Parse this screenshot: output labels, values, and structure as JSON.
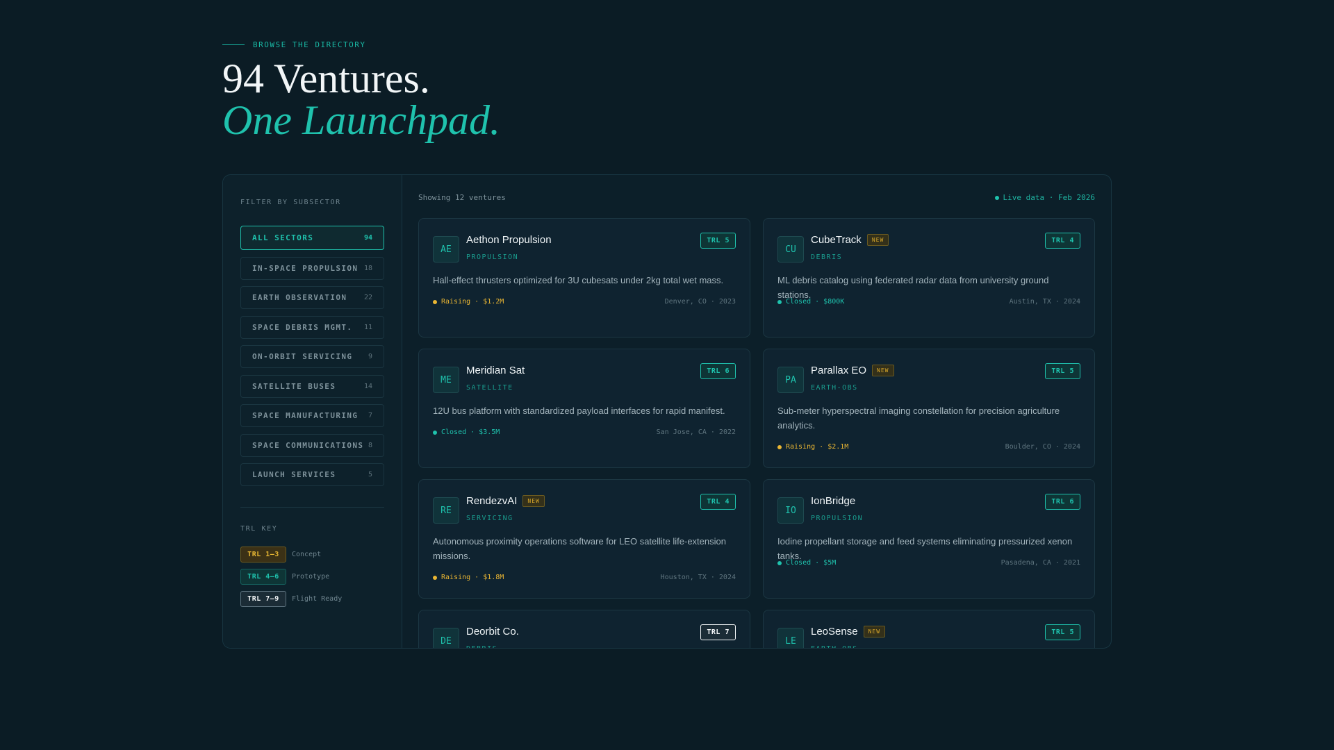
{
  "header": {
    "eyebrow": "BROWSE THE DIRECTORY",
    "title_line1": "94 Ventures.",
    "title_line2": "One Launchpad."
  },
  "sidebar": {
    "filter_title": "FILTER BY SUBSECTOR",
    "sectors": [
      {
        "label": "ALL SECTORS",
        "count": "94",
        "active": true
      },
      {
        "label": "IN-SPACE PROPULSION",
        "count": "18"
      },
      {
        "label": "EARTH OBSERVATION",
        "count": "22"
      },
      {
        "label": "SPACE DEBRIS MGMT.",
        "count": "11"
      },
      {
        "label": "ON-ORBIT SERVICING",
        "count": "9"
      },
      {
        "label": "SATELLITE BUSES",
        "count": "14"
      },
      {
        "label": "SPACE MANUFACTURING",
        "count": "7"
      },
      {
        "label": "SPACE COMMUNICATIONS",
        "count": "8"
      },
      {
        "label": "LAUNCH SERVICES",
        "count": "5"
      }
    ],
    "key_title": "TRL KEY",
    "key": [
      {
        "chip": "TRL 1–3",
        "label": "Concept",
        "level": "low"
      },
      {
        "chip": "TRL 4–6",
        "label": "Prototype",
        "level": "mid"
      },
      {
        "chip": "TRL 7–9",
        "label": "Flight Ready",
        "level": "high"
      }
    ]
  },
  "main": {
    "showing": "Showing 12 ventures",
    "live": "Live data · Feb 2026",
    "ventures": [
      {
        "initials": "AE",
        "name": "Aethon Propulsion",
        "new": false,
        "sector": "PROPULSION",
        "trl": "TRL 5",
        "trl_level": "mid",
        "desc": "Hall-effect thrusters optimized for 3U cubesats under 2kg total wet mass.",
        "status": "Raising · $1.2M",
        "status_kind": "raising",
        "location": "Denver, CO · 2023"
      },
      {
        "initials": "CU",
        "name": "CubeTrack",
        "new": true,
        "sector": "DEBRIS",
        "trl": "TRL 4",
        "trl_level": "mid",
        "desc": "ML debris catalog using federated radar data from university ground stations.",
        "status": "Closed · $800K",
        "status_kind": "closed",
        "location": "Austin, TX · 2024"
      },
      {
        "initials": "ME",
        "name": "Meridian Sat",
        "new": false,
        "sector": "SATELLITE",
        "trl": "TRL 6",
        "trl_level": "mid",
        "desc": "12U bus platform with standardized payload interfaces for rapid manifest.",
        "status": "Closed · $3.5M",
        "status_kind": "closed",
        "location": "San Jose, CA · 2022"
      },
      {
        "initials": "PA",
        "name": "Parallax EO",
        "new": true,
        "sector": "EARTH-OBS",
        "trl": "TRL 5",
        "trl_level": "mid",
        "desc": "Sub-meter hyperspectral imaging constellation for precision agriculture analytics.",
        "status": "Raising · $2.1M",
        "status_kind": "raising",
        "location": "Boulder, CO · 2024"
      },
      {
        "initials": "RE",
        "name": "RendezvAI",
        "new": true,
        "sector": "SERVICING",
        "trl": "TRL 4",
        "trl_level": "mid",
        "desc": "Autonomous proximity operations software for LEO satellite life-extension missions.",
        "status": "Raising · $1.8M",
        "status_kind": "raising",
        "location": "Houston, TX · 2024"
      },
      {
        "initials": "IO",
        "name": "IonBridge",
        "new": false,
        "sector": "PROPULSION",
        "trl": "TRL 6",
        "trl_level": "mid",
        "desc": "Iodine propellant storage and feed systems eliminating pressurized xenon tanks.",
        "status": "Closed · $5M",
        "status_kind": "closed",
        "location": "Pasadena, CA · 2021"
      },
      {
        "initials": "DE",
        "name": "Deorbit Co.",
        "new": false,
        "sector": "DEBRIS",
        "trl": "TRL 7",
        "trl_level": "high",
        "desc": "",
        "status": "",
        "status_kind": "",
        "location": ""
      },
      {
        "initials": "LE",
        "name": "LeoSense",
        "new": true,
        "sector": "EARTH-OBS",
        "trl": "TRL 5",
        "trl_level": "mid",
        "desc": "",
        "status": "",
        "status_kind": "",
        "location": ""
      }
    ],
    "new_badge": "NEW"
  }
}
